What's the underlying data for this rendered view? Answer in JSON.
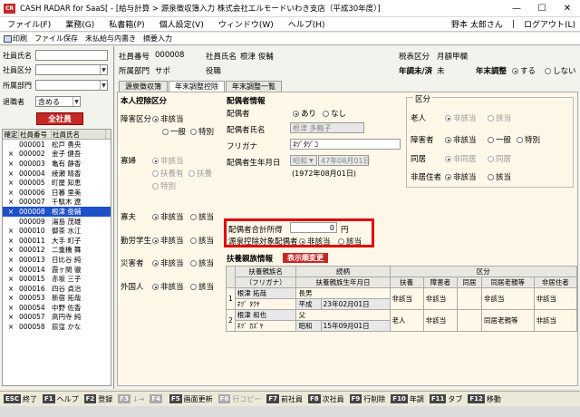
{
  "window": {
    "app_icon": "CR",
    "title": "CASH RADAR for SaaS[ - [給与計算 > 源泉徴収簿入力 株式会社エルモードいわき支店（平成30年度）]",
    "minimize": "—",
    "maximize": "☐",
    "close": "✕"
  },
  "menu": {
    "items": [
      "ファイル(F)",
      "業務(G)",
      "私書箱(P)",
      "個人設定(V)",
      "ウィンドウ(W)",
      "ヘルプ(H)"
    ],
    "user": "野本 太郎さん",
    "logout": "ログアウト(L)"
  },
  "toolbar": {
    "print": "印刷",
    "file_save": "ファイル保存",
    "unpaid": "未払給与内書き",
    "summary": "摘要入力"
  },
  "left": {
    "emp_name_label": "社員氏名",
    "emp_class_label": "社員区分",
    "dept_label": "所属部門",
    "retired_label": "退職者",
    "retired_value": "含める",
    "all_btn": "全社員",
    "headers": [
      "確定",
      "社員番号",
      "社員氏名"
    ],
    "rows": [
      {
        "mark": "",
        "no": "000001",
        "name": "松戸 勇央"
      },
      {
        "mark": "×",
        "no": "000002",
        "name": "金子 健吾"
      },
      {
        "mark": "×",
        "no": "000003",
        "name": "亀有 静香"
      },
      {
        "mark": "×",
        "no": "000004",
        "name": "綾瀬 晴香"
      },
      {
        "mark": "×",
        "no": "000005",
        "name": "町屋 知恵"
      },
      {
        "mark": "×",
        "no": "000006",
        "name": "日暮 里美"
      },
      {
        "mark": "×",
        "no": "000007",
        "name": "千駄木 遼"
      },
      {
        "mark": "×",
        "no": "000008",
        "name": "根津 俊輔"
      },
      {
        "mark": "",
        "no": "000009",
        "name": "湯島 茂雄"
      },
      {
        "mark": "×",
        "no": "000010",
        "name": "御茶 水江"
      },
      {
        "mark": "×",
        "no": "000011",
        "name": "大手 町子"
      },
      {
        "mark": "×",
        "no": "000012",
        "name": "二重橋 舞"
      },
      {
        "mark": "×",
        "no": "000013",
        "name": "日比谷 純"
      },
      {
        "mark": "×",
        "no": "000014",
        "name": "霞ヶ関 徹"
      },
      {
        "mark": "×",
        "no": "000015",
        "name": "赤坂 三子"
      },
      {
        "mark": "×",
        "no": "000016",
        "name": "四谷 貞治"
      },
      {
        "mark": "×",
        "no": "000053",
        "name": "新宿 拓哉"
      },
      {
        "mark": "×",
        "no": "000054",
        "name": "中野 佐香"
      },
      {
        "mark": "×",
        "no": "000057",
        "name": "高円寺 純"
      },
      {
        "mark": "×",
        "no": "000058",
        "name": "荻窪 かな"
      }
    ]
  },
  "header": {
    "emp_no_label": "社員番号",
    "emp_no": "000008",
    "emp_name_label": "社員氏名",
    "emp_name": "根津 俊輔",
    "dept_label": "所属部門",
    "dept": "サポ",
    "post_label": "役職",
    "tax_class_label": "税表区分",
    "tax_class": "月額甲欄",
    "nencho_label": "年調未/済",
    "nencho": "未",
    "nencho_adj_label": "年末調整",
    "nencho_yes": "する",
    "nencho_no": "しない"
  },
  "tabs": [
    "源泉徴収簿",
    "年末調整控除",
    "年末調整一覧"
  ],
  "deduction": {
    "title": "本人控除区分",
    "disability_label": "障害区分",
    "none": "非該当",
    "general": "一般",
    "special": "特別",
    "widow_label": "寡婦",
    "dep_yes": "扶養有",
    "dep": "扶養",
    "widower_label": "寡夫",
    "applicable": "該当",
    "student_label": "勤労学生",
    "disaster_label": "災害者",
    "foreigner_label": "外国人"
  },
  "spouse": {
    "title": "配偶者情報",
    "spouse_label": "配偶者",
    "yes": "あり",
    "no": "なし",
    "name_label": "配偶者氏名",
    "name": "根津 多鶴子",
    "kana_label": "フリガナ",
    "kana": "ﾈﾂﾞﾀﾂﾞｺ",
    "birth_label": "配偶者生年月日",
    "era": "昭和",
    "birth": "47年08月01日",
    "birth_western": "(1972年08月01日)",
    "income_label": "配偶者合計所得",
    "income": "0",
    "yen": "円",
    "withhold_label": "源泉控除対象配偶者",
    "none": "非該当",
    "applicable": "該当"
  },
  "category": {
    "title": "区分",
    "elderly_label": "老人",
    "disabled_label": "障害者",
    "living_label": "同居",
    "nonresident_label": "非居住者",
    "none": "非該当",
    "applicable": "該当",
    "general": "一般",
    "special": "特別",
    "nonliving": "非同居"
  },
  "dependents": {
    "title": "扶養親族情報",
    "change_btn": "表示順変更",
    "h_name": "扶養親族名",
    "h_kana": "（フリガナ）",
    "h_rel": "続柄",
    "h_birth": "扶養親族生年月日",
    "h_cat": "区分",
    "h_sub": [
      "扶養",
      "障害者",
      "同居",
      "同居老親等",
      "非居住者"
    ],
    "rows": [
      {
        "no": "1",
        "name": "根津 拓哉",
        "kana": "ﾈﾂﾞ ﾀｸﾔ",
        "rel": "長男",
        "era": "平成",
        "birth": "23年02月01日",
        "fuyo": "非該当",
        "shogai": "非該当",
        "dokyo": "",
        "rouoya": "非該当",
        "hikyo": "非該当"
      },
      {
        "no": "2",
        "name": "根津 和也",
        "kana": "ﾈﾂﾞ ｶｽﾞﾔ",
        "rel": "父",
        "era": "昭和",
        "birth": "15年09月01日",
        "fuyo": "老人",
        "shogai": "非該当",
        "dokyo": "",
        "rouoya": "同居老親等",
        "hikyo": "非該当"
      }
    ]
  },
  "fkeys": [
    {
      "key": "ESC",
      "label": "終了",
      "dim": false
    },
    {
      "key": "F1",
      "label": "ヘルプ",
      "dim": false
    },
    {
      "key": "F2",
      "label": "登録",
      "dim": false
    },
    {
      "key": "F3",
      "label": "↓→",
      "dim": true
    },
    {
      "key": "F4",
      "label": "",
      "dim": true
    },
    {
      "key": "F5",
      "label": "画面更新",
      "dim": false
    },
    {
      "key": "F6",
      "label": "行コピー",
      "dim": true
    },
    {
      "key": "F7",
      "label": "前社員",
      "dim": false
    },
    {
      "key": "F8",
      "label": "次社員",
      "dim": false
    },
    {
      "key": "F9",
      "label": "行削除",
      "dim": false
    },
    {
      "key": "F10",
      "label": "年調",
      "dim": false
    },
    {
      "key": "F11",
      "label": "タブ",
      "dim": false
    },
    {
      "key": "F12",
      "label": "移動",
      "dim": false
    }
  ]
}
